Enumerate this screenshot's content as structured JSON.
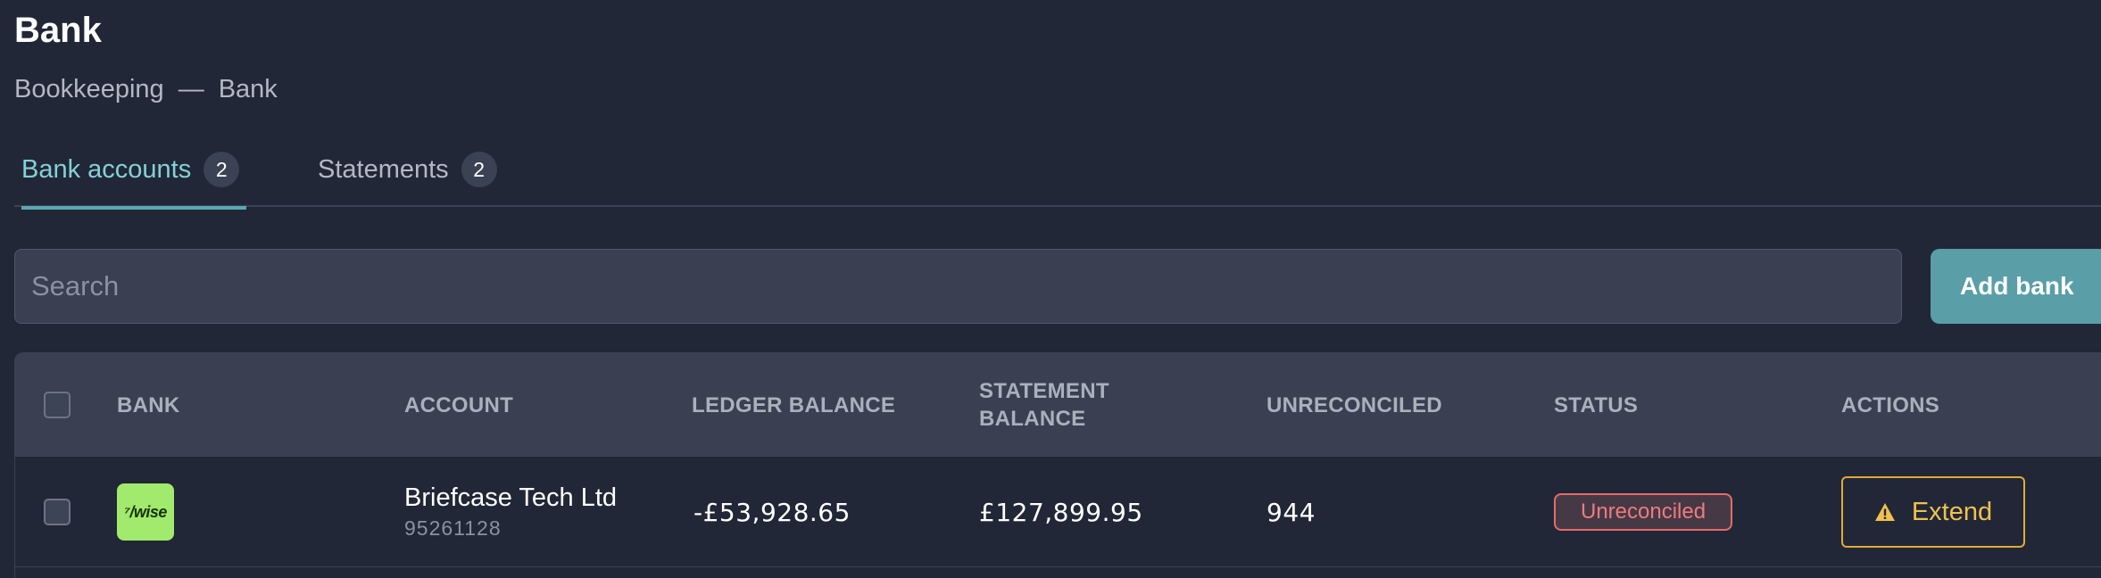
{
  "page": {
    "title": "Bank",
    "breadcrumb": {
      "parent": "Bookkeeping",
      "separator": "—",
      "current": "Bank"
    }
  },
  "tabs": [
    {
      "label": "Bank accounts",
      "count": "2",
      "active": true
    },
    {
      "label": "Statements",
      "count": "2",
      "active": false
    }
  ],
  "search": {
    "placeholder": "Search",
    "value": ""
  },
  "toolbar": {
    "add_bank_label": "Add bank"
  },
  "table": {
    "headers": {
      "bank": "BANK",
      "account": "ACCOUNT",
      "ledger_balance": "LEDGER BALANCE",
      "statement_balance": "STATEMENT BALANCE",
      "unreconciled": "UNRECONCILED",
      "status": "STATUS",
      "actions": "ACTIONS"
    },
    "rows": [
      {
        "bank_logo_text": "⁷/wise",
        "bank_logo_icon": "wise-logo-icon",
        "account_name": "Briefcase Tech Ltd",
        "account_number": "95261128",
        "ledger_balance": "-£53,928.65",
        "statement_balance": "£127,899.95",
        "unreconciled": "944",
        "status": "Unreconciled",
        "action_label": "Extend",
        "action_icon": "warning-icon"
      }
    ]
  },
  "colors": {
    "background": "#212736",
    "accent": "#5a9ea8",
    "active_tab": "#85d0d9",
    "status_unreconciled": "#ef7b7b",
    "warning": "#f1c04f",
    "wise_brand": "#a1ea6d"
  }
}
